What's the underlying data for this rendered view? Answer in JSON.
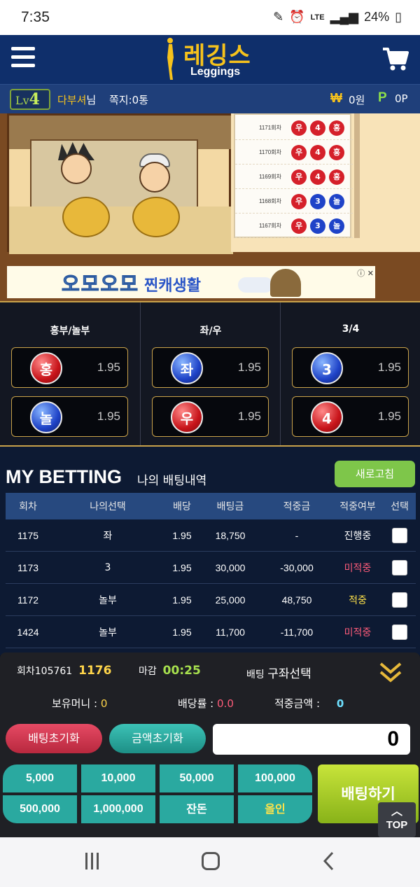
{
  "status": {
    "time": "7:35",
    "network": "LTE",
    "battery": "24%"
  },
  "header": {
    "logo_ko": "레깅스",
    "logo_en": "Leggings"
  },
  "user": {
    "level_prefix": "Lv",
    "level": "4",
    "name": "다부셔",
    "honorific": "님",
    "messages": "쪽지:0통",
    "won_symbol": "₩",
    "won": "0원",
    "point_symbol": "P",
    "points": "0P"
  },
  "game": {
    "recent_results": [
      {
        "round": "1171회차",
        "side": "우",
        "num": "4",
        "type": "홍"
      },
      {
        "round": "1170회차",
        "side": "우",
        "num": "4",
        "type": "홍"
      },
      {
        "round": "1169회차",
        "side": "우",
        "num": "4",
        "type": "홍"
      },
      {
        "round": "1168회차",
        "side": "우",
        "num": "3",
        "type": "놀"
      },
      {
        "round": "1167회차",
        "side": "우",
        "num": "3",
        "type": "놀"
      }
    ],
    "ad": {
      "text1": "오모오모",
      "text2": "찐캐생활",
      "close": "ⓘ ✕"
    }
  },
  "odds": [
    {
      "header": "흥부/놀부",
      "options": [
        {
          "label": "홍",
          "rate": "1.95",
          "color": "#c8141a"
        },
        {
          "label": "놀",
          "rate": "1.95",
          "color": "#1f43c8"
        }
      ]
    },
    {
      "header": "좌/우",
      "options": [
        {
          "label": "좌",
          "rate": "1.95",
          "color": "#1f43c8"
        },
        {
          "label": "우",
          "rate": "1.95",
          "color": "#c8141a"
        }
      ]
    },
    {
      "header": "3/4",
      "options": [
        {
          "label": "3",
          "rate": "1.95",
          "color": "#1f43c8"
        },
        {
          "label": "4",
          "rate": "1.95",
          "color": "#c8141a"
        }
      ]
    }
  ],
  "my_betting": {
    "title": "MY BETTING",
    "subtitle": "나의 배팅내역",
    "refresh": "새로고침",
    "columns": [
      "회차",
      "나의선택",
      "배당",
      "배팅금",
      "적중금",
      "적중여부",
      "선택"
    ],
    "rows": [
      {
        "round": "1175",
        "pick": "좌",
        "odds": "1.95",
        "stake": "18,750",
        "payout": "-",
        "status": "진행중",
        "status_type": "prog"
      },
      {
        "round": "1173",
        "pick": "3",
        "odds": "1.95",
        "stake": "30,000",
        "payout": "-30,000",
        "status": "미적중",
        "status_type": "miss"
      },
      {
        "round": "1172",
        "pick": "놀부",
        "odds": "1.95",
        "stake": "25,000",
        "payout": "48,750",
        "status": "적중",
        "status_type": "hit"
      },
      {
        "round": "1424",
        "pick": "놀부",
        "odds": "1.95",
        "stake": "11,700",
        "payout": "-11,700",
        "status": "미적중",
        "status_type": "miss"
      }
    ]
  },
  "slip": {
    "round_label": "회차",
    "round_id": "105761",
    "round_no": "1176",
    "deadline_label": "마감",
    "deadline": "00:25",
    "bet_label": "배팅",
    "bet_value": "구좌선택",
    "balance_label": "보유머니 :",
    "balance": "0",
    "odds_label": "배당률 :",
    "odds": "0.0",
    "win_label": "적중금액 :",
    "win": "0",
    "reset_bet": "배팅초기화",
    "reset_amount": "금액초기화",
    "amount": "0",
    "chips": [
      "5,000",
      "10,000",
      "50,000",
      "100,000",
      "500,000",
      "1,000,000",
      "잔돈",
      "올인"
    ],
    "bet_button": "배팅하기",
    "top_button": "TOP"
  }
}
